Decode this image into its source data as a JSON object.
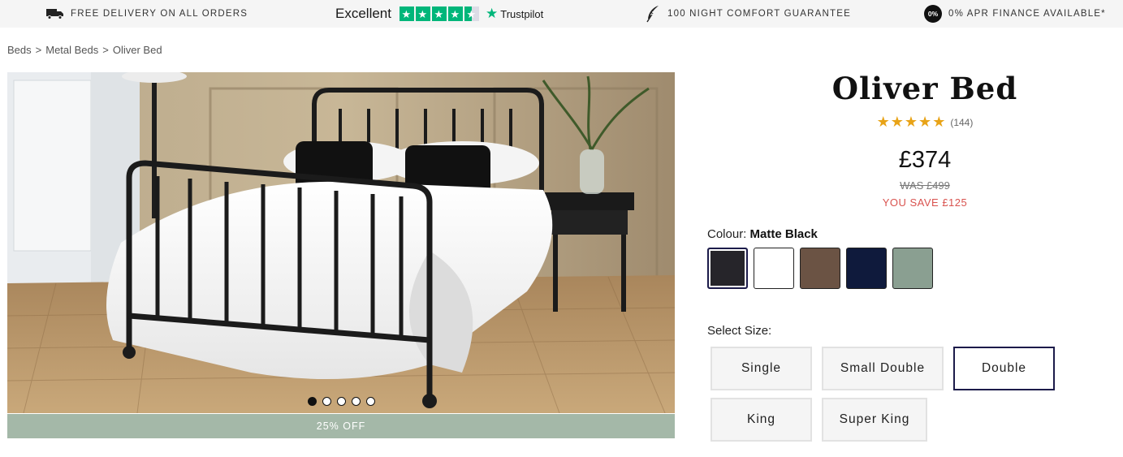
{
  "usp_bar": {
    "delivery": "FREE DELIVERY ON ALL ORDERS",
    "trust_rating": "Excellent",
    "trust_brand": "Trustpilot",
    "trust_stars": 4.5,
    "guarantee": "100 NIGHT COMFORT GUARANTEE",
    "finance_badge": "0%",
    "finance": "0% APR FINANCE AVAILABLE*"
  },
  "breadcrumb": {
    "items": [
      "Beds",
      "Metal Beds",
      "Oliver Bed"
    ],
    "separator": ">"
  },
  "gallery": {
    "promo": "25% OFF",
    "slide_count": 5,
    "active_slide": 1
  },
  "product": {
    "title": "Oliver Bed",
    "stars": "★★★★★",
    "rating": 5,
    "review_count": "(144)",
    "price": "£374",
    "was_price": "WAS £499",
    "saving": "YOU SAVE £125",
    "star_color": "#e8a317",
    "sale_color": "#d9534f"
  },
  "colour": {
    "label": "Colour:",
    "selected": "Matte Black",
    "swatches": [
      {
        "name": "Matte Black",
        "color": "#26252a"
      },
      {
        "name": "White",
        "color": "#ffffff"
      },
      {
        "name": "Brown",
        "color": "#6b5344"
      },
      {
        "name": "Navy",
        "color": "#0f1a3c"
      },
      {
        "name": "Sage",
        "color": "#8a9f91"
      }
    ]
  },
  "size": {
    "label": "Select Size:",
    "options": [
      "Single",
      "Small Double",
      "Double",
      "King",
      "Super King"
    ],
    "selected": "Double"
  }
}
